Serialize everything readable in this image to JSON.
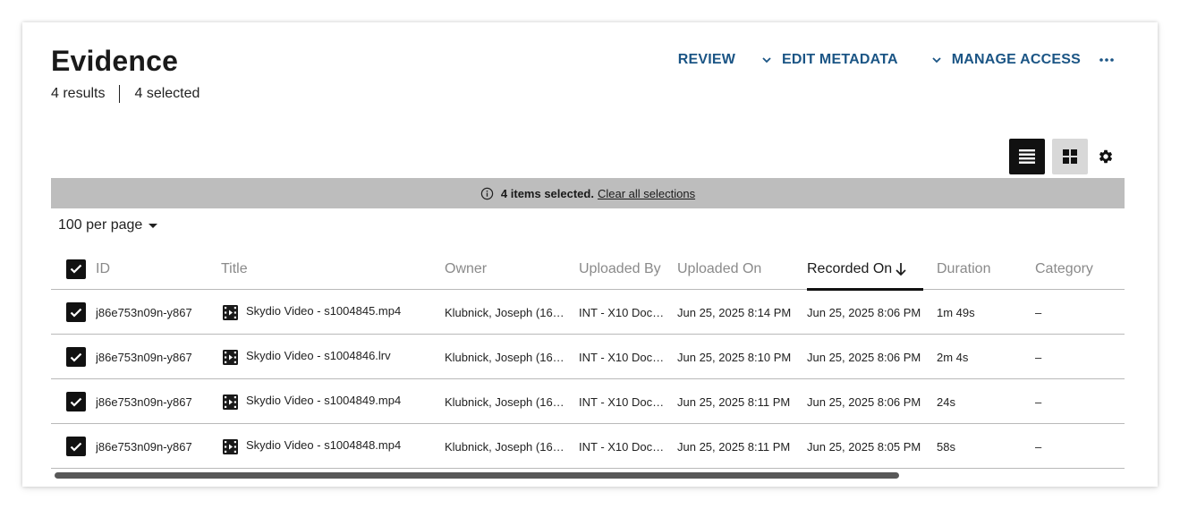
{
  "header": {
    "title": "Evidence",
    "results": "4 results",
    "selected": "4 selected"
  },
  "actions": {
    "review": "REVIEW",
    "edit_metadata": "EDIT METADATA",
    "manage_access": "MANAGE ACCESS"
  },
  "banner": {
    "count": "4 items selected.",
    "clear": "Clear all selections"
  },
  "pagination": {
    "per_page": "100 per page"
  },
  "columns": {
    "id": "ID",
    "title": "Title",
    "owner": "Owner",
    "uploaded_by": "Uploaded By",
    "uploaded_on": "Uploaded On",
    "recorded_on": "Recorded On",
    "duration": "Duration",
    "category": "Category"
  },
  "rows": [
    {
      "id": "j86e753n09n-y867",
      "title": "Skydio Video - s1004845.mp4",
      "owner": "Klubnick, Joseph (16…",
      "uploaded_by": "INT - X10 Doc…",
      "uploaded_on": "Jun 25, 2025 8:14 PM",
      "recorded_on": "Jun 25, 2025 8:06 PM",
      "duration": "1m 49s",
      "category": "–"
    },
    {
      "id": "j86e753n09n-y867",
      "title": "Skydio Video - s1004846.lrv",
      "owner": "Klubnick, Joseph (16…",
      "uploaded_by": "INT - X10 Doc…",
      "uploaded_on": "Jun 25, 2025 8:10 PM",
      "recorded_on": "Jun 25, 2025 8:06 PM",
      "duration": "2m 4s",
      "category": "–"
    },
    {
      "id": "j86e753n09n-y867",
      "title": "Skydio Video - s1004849.mp4",
      "owner": "Klubnick, Joseph (16…",
      "uploaded_by": "INT - X10 Doc…",
      "uploaded_on": "Jun 25, 2025 8:11 PM",
      "recorded_on": "Jun 25, 2025 8:06 PM",
      "duration": "24s",
      "category": "–"
    },
    {
      "id": "j86e753n09n-y867",
      "title": "Skydio Video - s1004848.mp4",
      "owner": "Klubnick, Joseph (16…",
      "uploaded_by": "INT - X10 Doc…",
      "uploaded_on": "Jun 25, 2025 8:11 PM",
      "recorded_on": "Jun 25, 2025 8:05 PM",
      "duration": "58s",
      "category": "–"
    }
  ],
  "colors": {
    "action_blue": "#1b5585",
    "banner_gray": "#bdbdbd",
    "checkbox_black": "#111111"
  },
  "icons": {
    "more": "more-horizontal-icon",
    "list_view": "list-view-icon",
    "grid_view": "grid-view-icon",
    "settings": "gear-icon",
    "info": "info-icon",
    "file": "video-file-icon",
    "sort": "arrow-down-icon"
  }
}
